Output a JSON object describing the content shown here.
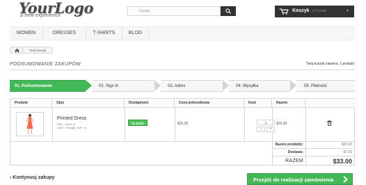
{
  "logo": {
    "main": "YourLogo",
    "sub": "a new experience"
  },
  "search": {
    "placeholder": "Szukaj"
  },
  "cart": {
    "title": "Koszyk",
    "count": "1 Produkt"
  },
  "nav": {
    "items": [
      "WOMEN",
      "DRESSES",
      "T-SHIRTS",
      "BLOG"
    ]
  },
  "breadcrumb": {
    "current": "Twój koszyk"
  },
  "page": {
    "heading": "PODSUMOWANIE ZAKUPÓW",
    "summary": "Twój koszyk zawiera: 1 produkt"
  },
  "steps": [
    "01. Podsumowanie",
    "02. Sign in",
    "03. Adres",
    "04. Wysyłka",
    "05. Płatność"
  ],
  "table": {
    "headers": [
      "Produkt",
      "Opis",
      "Dostępność",
      "Cena jednostkowa",
      "Ilość",
      "Razem"
    ],
    "row": {
      "name": "Printed Dress",
      "sku": "SKU : demo_3",
      "attributes": "Color : Orange, Size : S",
      "availability": "In stock",
      "unit_price": "$26.00",
      "quantity": "1",
      "total": "$26.00"
    },
    "summary": {
      "products_label": "Razem produkty:",
      "products_value": "$26.00",
      "shipping_label": "Dostawa:",
      "shipping_value": "$7.00",
      "total_label": "RAZEM",
      "total_value": "$33.00"
    }
  },
  "actions": {
    "continue": "Kontynuuj zakupy",
    "checkout": "Przejdź do realizacji zamówienia"
  },
  "colors": {
    "accent_green": "#43b754",
    "dark": "#333333"
  }
}
